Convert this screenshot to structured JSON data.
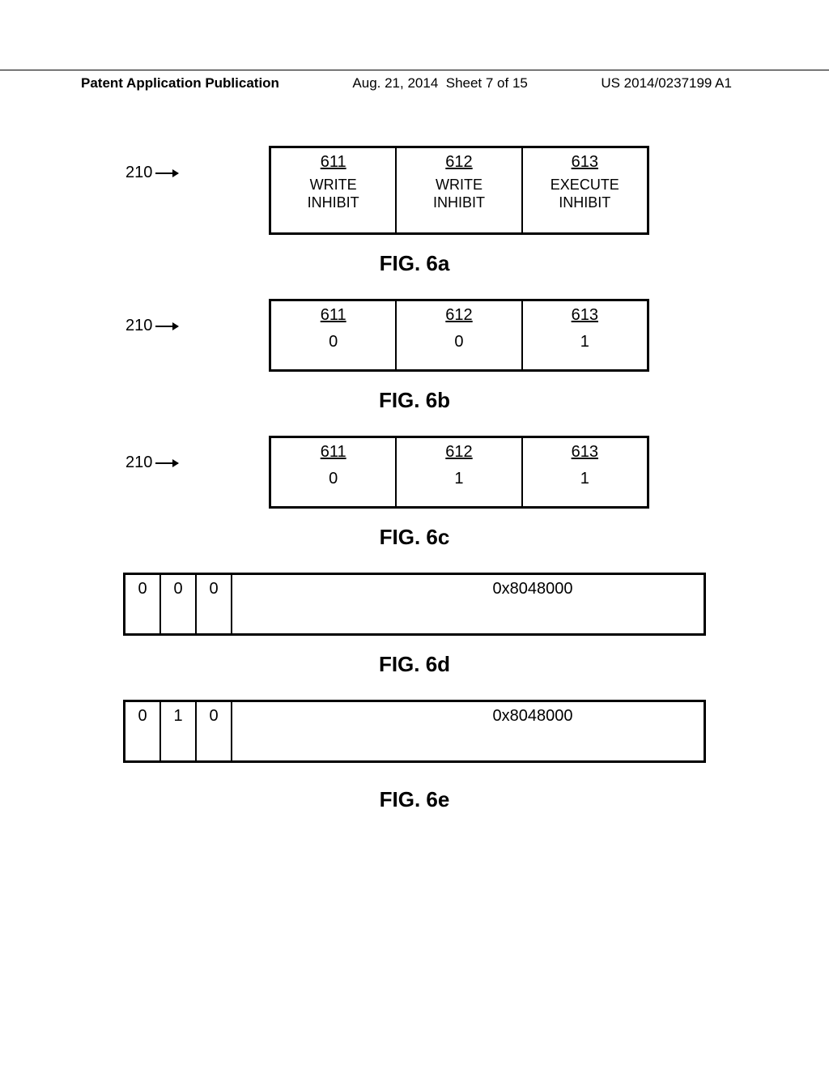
{
  "header": {
    "left": "Patent Application Publication",
    "date": "Aug. 21, 2014",
    "sheet": "Sheet 7 of 15",
    "pubno": "US 2014/0237199 A1"
  },
  "fig_a": {
    "ref": "210",
    "caption": "FIG. 6a",
    "cells": [
      {
        "ref": "611",
        "label1": "WRITE",
        "label2": "INHIBIT"
      },
      {
        "ref": "612",
        "label1": "WRITE",
        "label2": "INHIBIT"
      },
      {
        "ref": "613",
        "label1": "EXECUTE",
        "label2": "INHIBIT"
      }
    ]
  },
  "fig_b": {
    "ref": "210",
    "caption": "FIG. 6b",
    "cells": [
      {
        "ref": "611",
        "val": "0"
      },
      {
        "ref": "612",
        "val": "0"
      },
      {
        "ref": "613",
        "val": "1"
      }
    ]
  },
  "fig_c": {
    "ref": "210",
    "caption": "FIG. 6c",
    "cells": [
      {
        "ref": "611",
        "val": "0"
      },
      {
        "ref": "612",
        "val": "1"
      },
      {
        "ref": "613",
        "val": "1"
      }
    ]
  },
  "fig_d": {
    "caption": "FIG. 6d",
    "bits": [
      "0",
      "0",
      "0"
    ],
    "addr": "0x8048000"
  },
  "fig_e": {
    "caption": "FIG. 6e",
    "bits": [
      "0",
      "1",
      "0"
    ],
    "addr": "0x8048000"
  },
  "chart_data": [
    {
      "type": "table",
      "title": "FIG. 6a — register 210 field labels",
      "columns": [
        "611",
        "612",
        "613"
      ],
      "rows": [
        [
          "WRITE INHIBIT",
          "WRITE INHIBIT",
          "EXECUTE INHIBIT"
        ]
      ]
    },
    {
      "type": "table",
      "title": "FIG. 6b — register 210 values",
      "columns": [
        "611",
        "612",
        "613"
      ],
      "rows": [
        [
          0,
          0,
          1
        ]
      ]
    },
    {
      "type": "table",
      "title": "FIG. 6c — register 210 values",
      "columns": [
        "611",
        "612",
        "613"
      ],
      "rows": [
        [
          0,
          1,
          1
        ]
      ]
    },
    {
      "type": "table",
      "title": "FIG. 6d — entry",
      "columns": [
        "bit0",
        "bit1",
        "bit2",
        "address"
      ],
      "rows": [
        [
          0,
          0,
          0,
          "0x8048000"
        ]
      ]
    },
    {
      "type": "table",
      "title": "FIG. 6e — entry",
      "columns": [
        "bit0",
        "bit1",
        "bit2",
        "address"
      ],
      "rows": [
        [
          0,
          1,
          0,
          "0x8048000"
        ]
      ]
    }
  ]
}
